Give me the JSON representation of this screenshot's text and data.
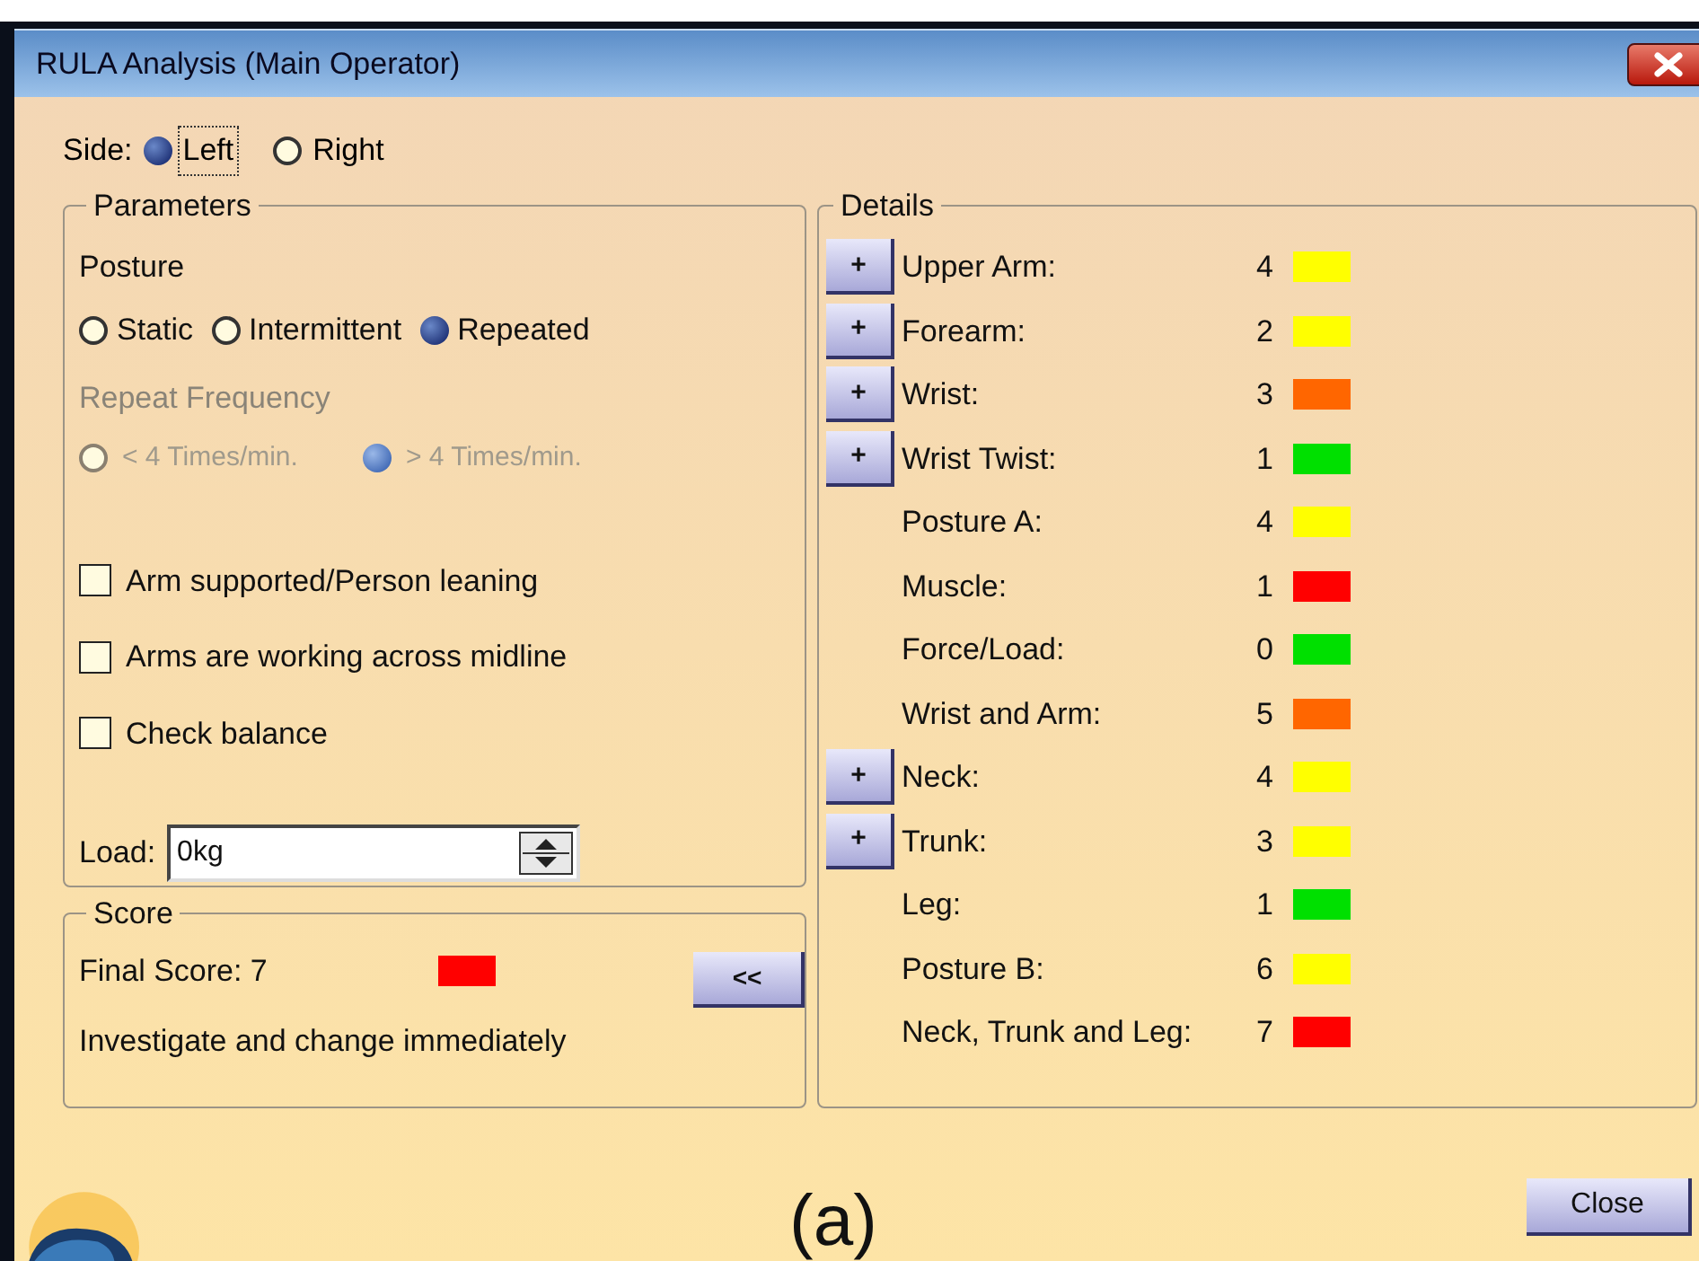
{
  "window": {
    "title": "RULA Analysis (Main Operator)"
  },
  "side": {
    "label": "Side:",
    "options": [
      {
        "label": "Left",
        "selected": true
      },
      {
        "label": "Right",
        "selected": false
      }
    ]
  },
  "parameters": {
    "title": "Parameters",
    "posture_label": "Posture",
    "posture_options": [
      {
        "label": "Static",
        "selected": false
      },
      {
        "label": "Intermittent",
        "selected": false
      },
      {
        "label": "Repeated",
        "selected": true
      }
    ],
    "repeat_frequency": {
      "label": "Repeat Frequency",
      "disabled": true,
      "options": [
        {
          "label": "< 4 Times/min.",
          "selected": false
        },
        {
          "label": "> 4 Times/min.",
          "selected": true
        }
      ]
    },
    "checkboxes": [
      {
        "label": "Arm supported/Person leaning",
        "checked": false
      },
      {
        "label": "Arms are working across midline",
        "checked": false
      },
      {
        "label": "Check balance",
        "checked": false
      }
    ],
    "load": {
      "label": "Load:",
      "value": "0kg"
    }
  },
  "score": {
    "title": "Score",
    "final_score": "Final Score: 7",
    "color": "#ff0000",
    "message": "Investigate and change immediately",
    "collapse_button": "<<"
  },
  "details": {
    "title": "Details",
    "rows": [
      {
        "label": "Upper Arm:",
        "value": "4",
        "color": "#ffff00",
        "expandable": true,
        "expand_button": "+"
      },
      {
        "label": "Forearm:",
        "value": "2",
        "color": "#ffff00",
        "expandable": true,
        "expand_button": "+"
      },
      {
        "label": "Wrist:",
        "value": "3",
        "color": "#ff6600",
        "expandable": true,
        "expand_button": "+"
      },
      {
        "label": "Wrist Twist:",
        "value": "1",
        "color": "#00e000",
        "expandable": true,
        "expand_button": "+"
      },
      {
        "label": "Posture A:",
        "value": "4",
        "color": "#ffff00",
        "expandable": false
      },
      {
        "label": "Muscle:",
        "value": "1",
        "color": "#ff0000",
        "expandable": false
      },
      {
        "label": "Force/Load:",
        "value": "0",
        "color": "#00e000",
        "expandable": false
      },
      {
        "label": "Wrist and Arm:",
        "value": "5",
        "color": "#ff6600",
        "expandable": false
      },
      {
        "label": "Neck:",
        "value": "4",
        "color": "#ffff00",
        "expandable": true,
        "expand_button": "+"
      },
      {
        "label": "Trunk:",
        "value": "3",
        "color": "#ffff00",
        "expandable": true,
        "expand_button": "+"
      },
      {
        "label": "Leg:",
        "value": "1",
        "color": "#00e000",
        "expandable": false
      },
      {
        "label": "Posture B:",
        "value": "6",
        "color": "#ffff00",
        "expandable": false
      },
      {
        "label": "Neck, Trunk and Leg:",
        "value": "7",
        "color": "#ff0000",
        "expandable": false
      }
    ]
  },
  "close_button": "Close",
  "caption": "(a)"
}
